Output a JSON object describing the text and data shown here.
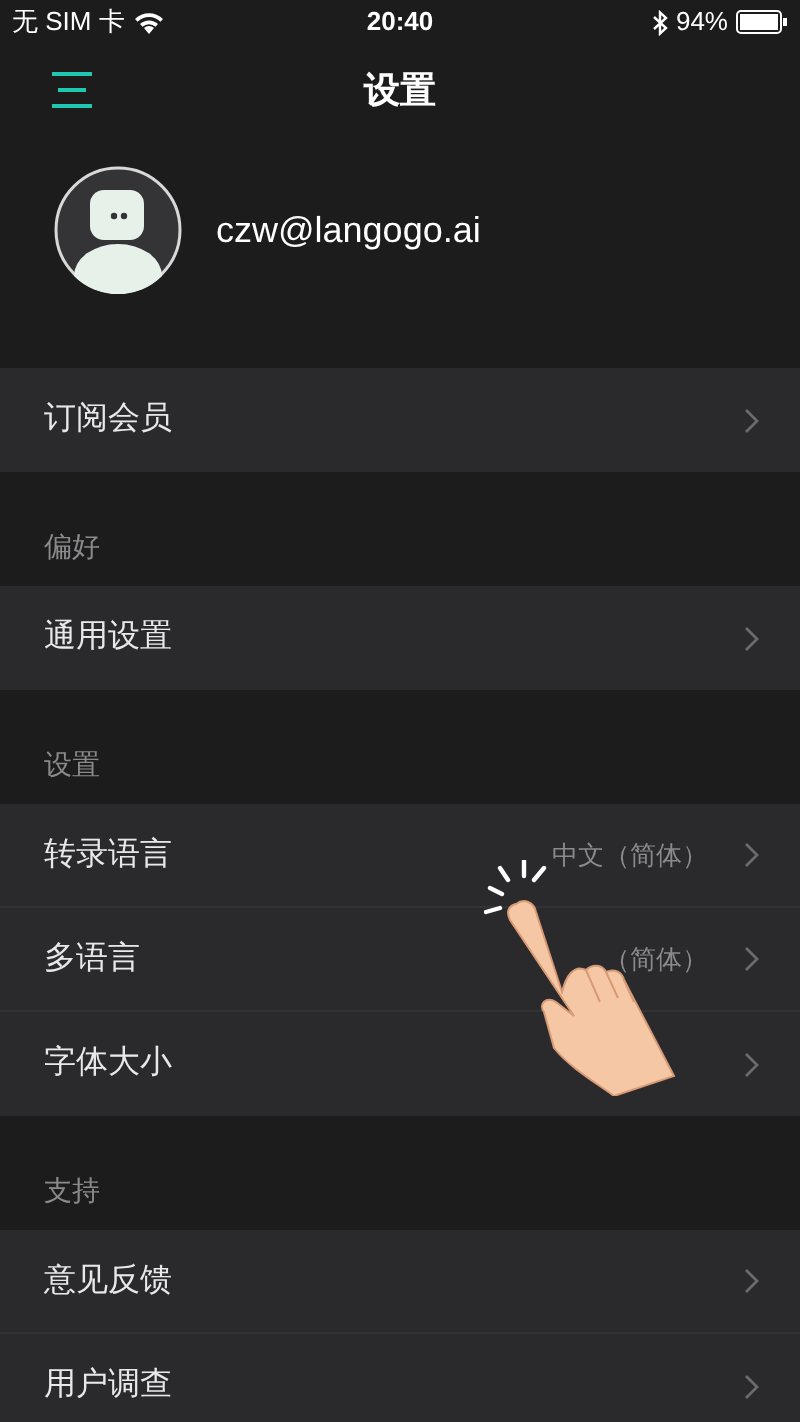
{
  "status_bar": {
    "carrier": "无 SIM 卡",
    "time": "20:40",
    "battery": "94%"
  },
  "nav": {
    "title": "设置"
  },
  "profile": {
    "email": "czw@langogo.ai"
  },
  "sections": [
    {
      "items": [
        {
          "label": "订阅会员"
        }
      ]
    },
    {
      "header": "偏好",
      "items": [
        {
          "label": "通用设置"
        }
      ]
    },
    {
      "header": "设置",
      "items": [
        {
          "label": "转录语言",
          "value": "中文（简体）"
        },
        {
          "label": "多语言",
          "value": "（简体）"
        },
        {
          "label": "字体大小"
        }
      ]
    },
    {
      "header": "支持",
      "items": [
        {
          "label": "意见反馈"
        },
        {
          "label": "用户调查"
        }
      ]
    }
  ]
}
